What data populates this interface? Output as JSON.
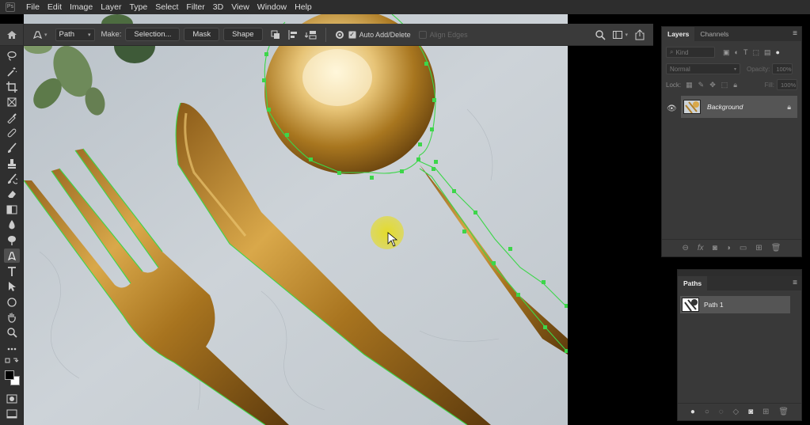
{
  "menu": {
    "app_mark": "Ps",
    "items": [
      "File",
      "Edit",
      "Image",
      "Layer",
      "Type",
      "Select",
      "Filter",
      "3D",
      "View",
      "Window",
      "Help"
    ]
  },
  "options": {
    "mode_value": "Path",
    "make_label": "Make:",
    "selection_label": "Selection...",
    "mask_label": "Mask",
    "shape_label": "Shape",
    "auto_add_delete": "Auto Add/Delete",
    "align_edges": "Align Edges",
    "auto_add_delete_checked": true,
    "align_edges_checked": false
  },
  "layers_panel": {
    "tab_layers": "Layers",
    "tab_channels": "Channels",
    "kind_placeholder": "Kind",
    "blend_mode": "Normal",
    "opacity_label": "Opacity:",
    "opacity_value": "100%",
    "lock_label": "Lock:",
    "fill_label": "Fill:",
    "fill_value": "100%",
    "layer_name": "Background"
  },
  "paths_panel": {
    "tab_paths": "Paths",
    "path_name": "Path 1"
  },
  "colors": {
    "path_stroke": "#3dd64a",
    "cursor_highlight": "#e6dc20"
  }
}
